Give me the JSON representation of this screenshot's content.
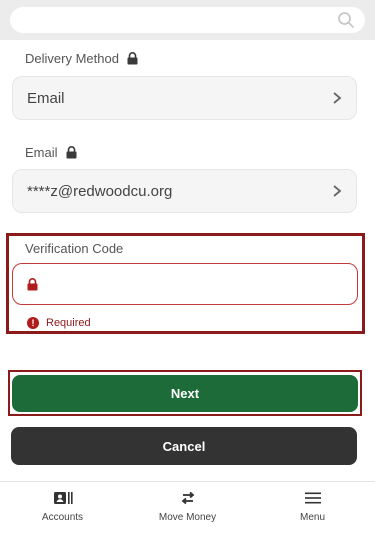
{
  "search": {
    "placeholder": ""
  },
  "delivery_method": {
    "label": "Delivery Method",
    "value": "Email"
  },
  "email": {
    "label": "Email",
    "value": "****z@redwoodcu.org"
  },
  "verification": {
    "label": "Verification Code",
    "value": "",
    "error": "Required"
  },
  "actions": {
    "next_label": "Next",
    "cancel_label": "Cancel"
  },
  "bottom_nav": {
    "items": [
      {
        "label": "Accounts",
        "icon": "accounts-icon"
      },
      {
        "label": "Move Money",
        "icon": "transfer-arrows-icon"
      },
      {
        "label": "Menu",
        "icon": "hamburger-menu-icon"
      }
    ]
  },
  "colors": {
    "primary_button": "#1e6b3a",
    "secondary_button": "#333333",
    "error": "#b01c1c",
    "highlight_border": "#8b1a1a"
  }
}
